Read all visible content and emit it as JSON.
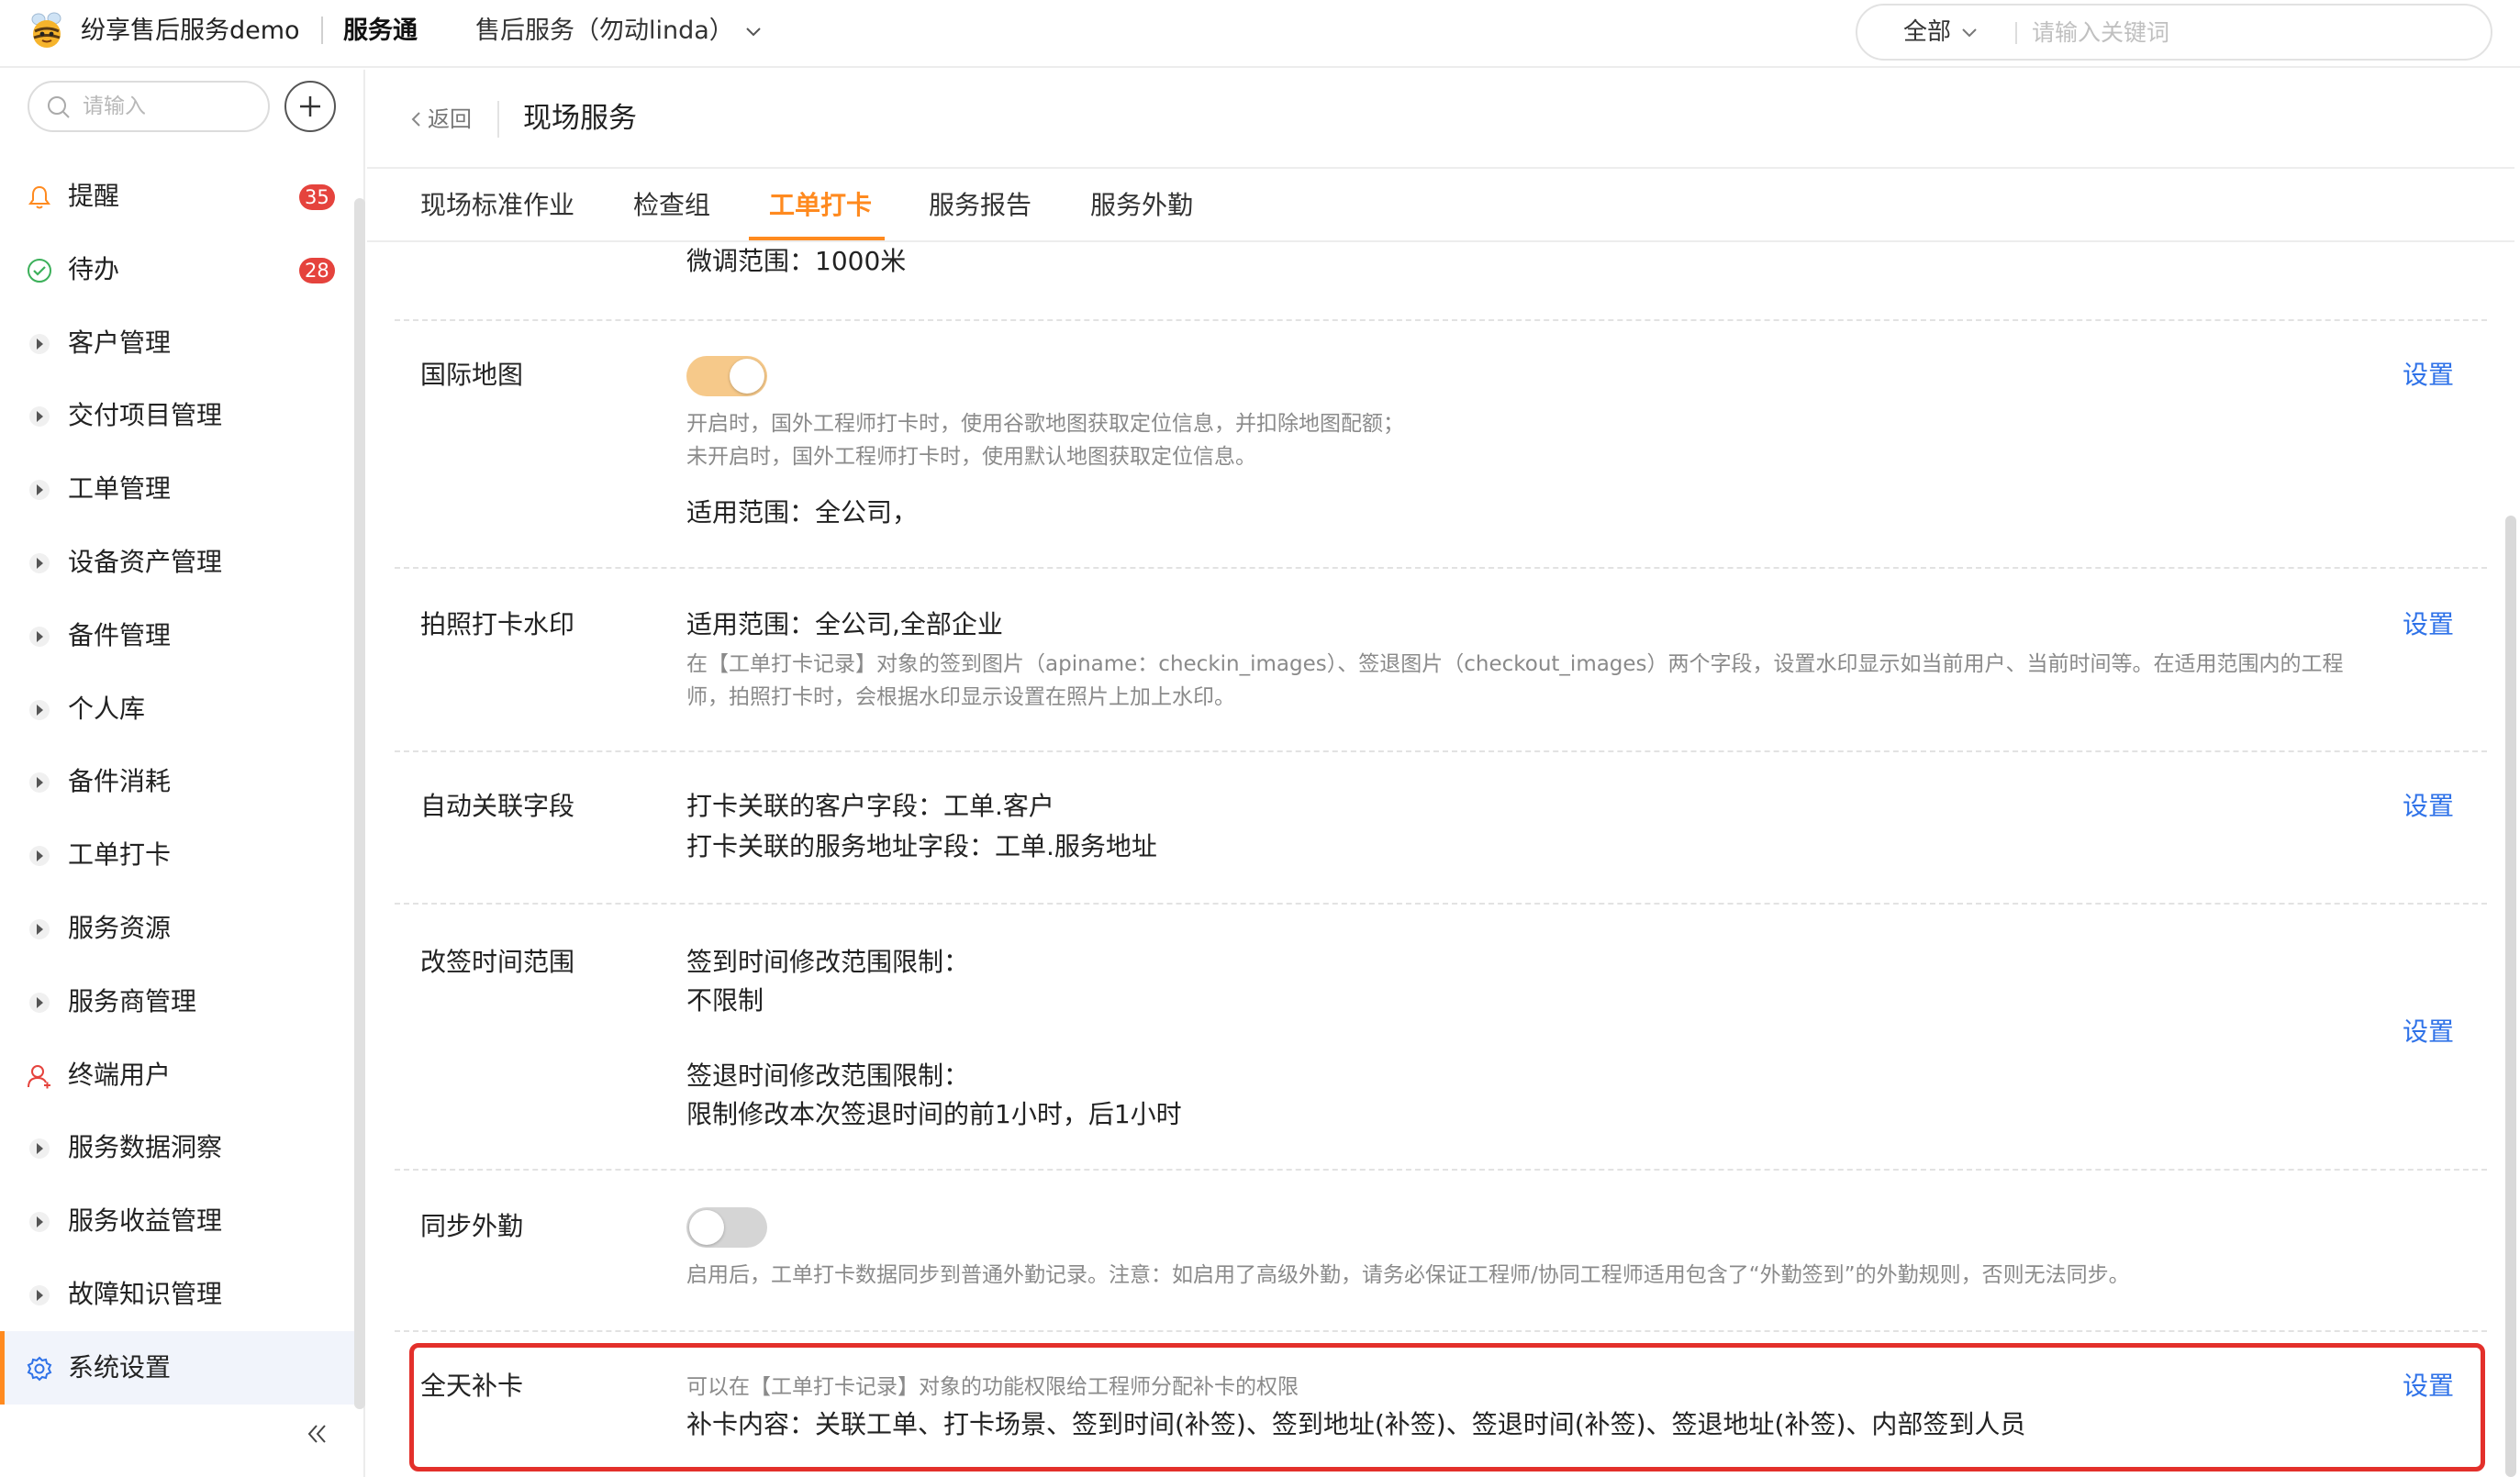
{
  "topbar": {
    "company": "纷享售后服务demo",
    "app_name": "服务通",
    "service_selector": "售后服务（勿动linda）",
    "search_scope": "全部",
    "search_placeholder": "请输入关键词"
  },
  "sidebar": {
    "search_placeholder": "请输入",
    "items": [
      {
        "label": "提醒",
        "badge": "35",
        "icon": "bell-icon"
      },
      {
        "label": "待办",
        "badge": "28",
        "icon": "check-circle-icon"
      },
      {
        "label": "客户管理",
        "icon": "caret-right-icon"
      },
      {
        "label": "交付项目管理",
        "icon": "caret-right-icon"
      },
      {
        "label": "工单管理",
        "icon": "caret-right-icon"
      },
      {
        "label": "设备资产管理",
        "icon": "caret-right-icon"
      },
      {
        "label": "备件管理",
        "icon": "caret-right-icon"
      },
      {
        "label": "个人库",
        "icon": "caret-right-icon"
      },
      {
        "label": "备件消耗",
        "icon": "caret-right-icon"
      },
      {
        "label": "工单打卡",
        "icon": "caret-right-icon"
      },
      {
        "label": "服务资源",
        "icon": "caret-right-icon"
      },
      {
        "label": "服务商管理",
        "icon": "caret-right-icon"
      },
      {
        "label": "终端用户",
        "icon": "user-icon"
      },
      {
        "label": "服务数据洞察",
        "icon": "caret-right-icon"
      },
      {
        "label": "服务收益管理",
        "icon": "caret-right-icon"
      },
      {
        "label": "故障知识管理",
        "icon": "caret-right-icon"
      },
      {
        "label": "系统设置",
        "icon": "gear-icon",
        "active": true
      }
    ]
  },
  "main": {
    "back_label": "返回",
    "title": "现场服务",
    "tabs": [
      "现场标准作业",
      "检查组",
      "工单打卡",
      "服务报告",
      "服务外勤"
    ],
    "active_tab": "工单打卡",
    "top_partial": "微调范围：1000米",
    "set_label": "设置",
    "sections": {
      "intl_map": {
        "label": "国际地图",
        "toggle": "on",
        "desc1": "开启时，国外工程师打卡时，使用谷歌地图获取定位信息，并扣除地图配额；",
        "desc2": "未开启时，国外工程师打卡时，使用默认地图获取定位信息。",
        "scope": "适用范围：全公司，"
      },
      "watermark": {
        "label": "拍照打卡水印",
        "scope": "适用范围：全公司,全部企业",
        "desc": "在【工单打卡记录】对象的签到图片（apiname：checkin_images）、签退图片（checkout_images）两个字段，设置水印显示如当前用户、当前时间等。在适用范围内的工程师，拍照打卡时，会根据水印显示设置在照片上加上水印。"
      },
      "auto_link": {
        "label": "自动关联字段",
        "line1": "打卡关联的客户字段：工单.客户",
        "line2": "打卡关联的服务地址字段：工单.服务地址"
      },
      "resign_time": {
        "label": "改签时间范围",
        "line1": "签到时间修改范围限制：",
        "line2": "不限制",
        "line3": "签退时间修改范围限制：",
        "line4": "限制修改本次签退时间的前1小时，后1小时"
      },
      "sync_outwork": {
        "label": "同步外勤",
        "toggle": "off",
        "desc": "启用后，工单打卡数据同步到普通外勤记录。注意：如启用了高级外勤，请务必保证工程师/协同工程师适用包含了“外勤签到”的外勤规则，否则无法同步。"
      },
      "allday_supplement": {
        "label": "全天补卡",
        "desc": "可以在【工单打卡记录】对象的功能权限给工程师分配补卡的权限",
        "content": "补卡内容：关联工单、打卡场景、签到时间(补签)、签到地址(补签)、签退时间(补签)、签退地址(补签)、内部签到人员"
      }
    }
  },
  "colors": {
    "accent": "#ff8a1f",
    "link": "#2f72e8",
    "badge": "#e5433d",
    "highlight": "#e3302b",
    "toggle_on": "#f6c98a"
  }
}
